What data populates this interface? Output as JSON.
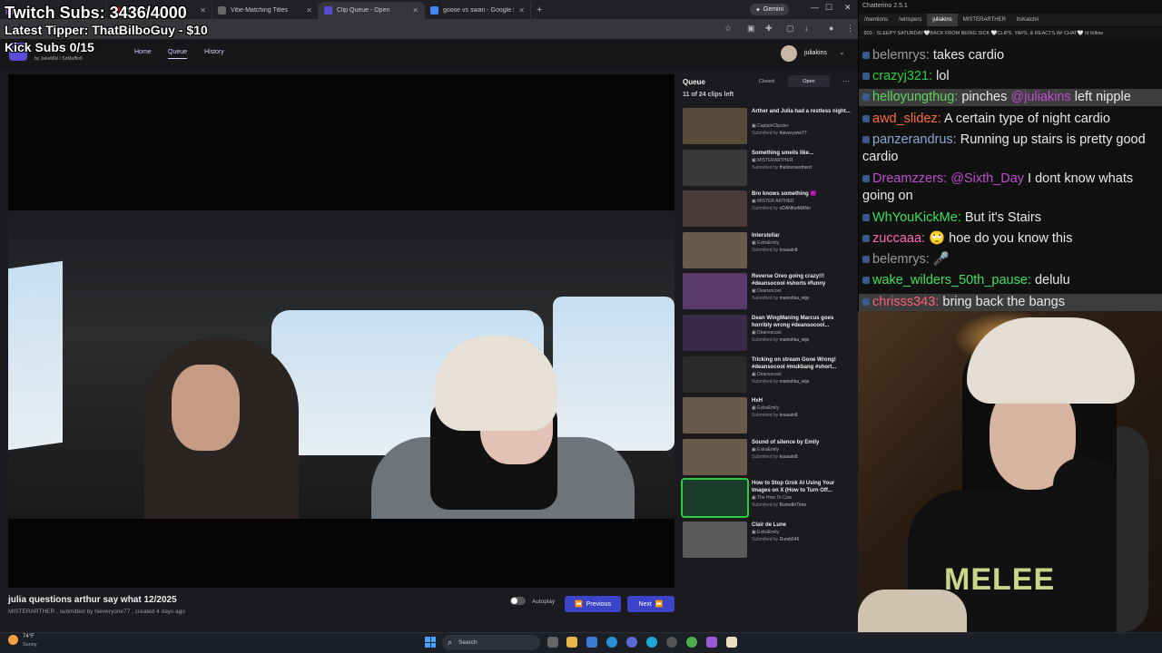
{
  "overlay": {
    "subs": "Twitch Subs: 3436/4000",
    "tipper": "Latest Tipper: ThatBilboGuy - $10",
    "kick": "Kick Subs 0/15"
  },
  "browser": {
    "tabs": [
      {
        "label": "",
        "color": "#6441a5"
      },
      {
        "label": "YouTube",
        "color": "#ff0000"
      },
      {
        "label": "Vibe-Matching Titles",
        "color": "#666666"
      },
      {
        "label": "Clip Queue - Open",
        "color": "#5b4bd6",
        "active": true
      },
      {
        "label": "goose vs swan - Google Search",
        "color": "#4285f4"
      }
    ],
    "new_tab": "+",
    "gemini": "Gemini",
    "win_min": "—",
    "win_max": "☐",
    "win_close": "✕"
  },
  "site": {
    "credits": "by JakeMiki / SirMuffin9",
    "nav": {
      "home": "Home",
      "queue": "Queue",
      "history": "History"
    },
    "user": "juliakins",
    "user_chevron": "⌄"
  },
  "clip": {
    "title": "julia questions arthur say what 12/2025",
    "meta": "MISTERARTHER , submitted by hieveryone77 , created 4 days ago",
    "autoplay": "Autoplay",
    "prev": "Previous",
    "next": "Next",
    "prev_icon": "⏪",
    "next_icon": "⏩"
  },
  "queue": {
    "title": "Queue",
    "count": "11 of 24 clips left",
    "closed": "Closed",
    "open": "Open",
    "more": "⋯",
    "items": [
      {
        "title": "Arther and Julia had a restless night...",
        "channel": "CaptainClipster",
        "by": "hieveryone77"
      },
      {
        "title": "Something smells like...",
        "channel": "MISTERARTHER",
        "by": "thelicensednerd"
      },
      {
        "title": "Bro knows something 😈",
        "channel": "MISTER ARTHER",
        "by": "oDANtheMANo"
      },
      {
        "title": "Interstellar",
        "channel": "ExtraEmily",
        "by": "kosaain8"
      },
      {
        "title": "Reverse Oreo going crazy!!! #deansocool #shorts #funny",
        "channel": "Deansocool",
        "by": "manishka_wije"
      },
      {
        "title": "Dean WingManing Marcus goes horribly wrong #deansocool...",
        "channel": "Deansocool",
        "by": "manishka_wije"
      },
      {
        "title": "Tricking on stream Gone Wrong! #deansocool #mukbang #short...",
        "channel": "Deansocool",
        "by": "manishka_wije"
      },
      {
        "title": "HxH",
        "channel": "ExtraEmily",
        "by": "kosaain8"
      },
      {
        "title": "Sound of silence by Emily",
        "channel": "ExtraEmily",
        "by": "kosaain8"
      },
      {
        "title": "How to Stop Grok AI Using Your Images on X (How to Turn Off...",
        "channel": "The How To Cow",
        "by": "BuriedInTime"
      },
      {
        "title": "Clair de Lune",
        "channel": "ExtraEmily",
        "by": "Dumb546"
      }
    ],
    "submitted_prefix": "Submitted by"
  },
  "chat": {
    "app_title": "Chatterino 2.5.1",
    "tabs": [
      "/mentions",
      "/whispers",
      "juliakins",
      "MISTERARTHER",
      "itsKatchii"
    ],
    "banner": ".903 - SLEEPY SATURDAY🤍BACK FROM BEING SICK 🤍CLIPS, YAPS, & REACTS W/ CHAT🤍 !d   follow",
    "messages": [
      {
        "user": "belemrys:",
        "text": "takes cardio",
        "color": "#9a9a9a"
      },
      {
        "user": "crazyj321:",
        "text": "lol",
        "color": "#2ecc40"
      },
      {
        "user": "helloyungthug:",
        "text": "pinches ",
        "mention": "@juliakins",
        "text2": " left nipple",
        "color": "#5fd35f",
        "hl": true
      },
      {
        "user": "awd_slidez:",
        "text": "A certain type of night cardio",
        "color": "#ff6b3d"
      },
      {
        "user": "panzerandrus:",
        "text": "Running up stairs is pretty good cardio",
        "color": "#8aa8d8"
      },
      {
        "user": "Dreamzzers:",
        "mention": "@Sixth_Day",
        "text": " I dont know whats going on",
        "color": "#c04cd0"
      },
      {
        "user": "WhYouKickMe:",
        "text": "But it's Stairs",
        "color": "#3de05a"
      },
      {
        "user": "zuccaaa:",
        "text": "🙄 hoe do you know this",
        "color": "#ff6ab4"
      },
      {
        "user": "belemrys:",
        "text": "🎤",
        "color": "#9a9a9a"
      },
      {
        "user": "wake_wilders_50th_pause:",
        "text": "delulu",
        "color": "#3de05a"
      },
      {
        "user": "chrisss343:",
        "text": "bring back the bangs",
        "color": "#ff5c7a",
        "hl": true
      }
    ],
    "mention_color": "#c04cd0"
  },
  "webcam": {
    "shirt_text": "MELEE"
  },
  "taskbar": {
    "temp": "74°F",
    "weather": "Sunny",
    "search": "Search"
  }
}
